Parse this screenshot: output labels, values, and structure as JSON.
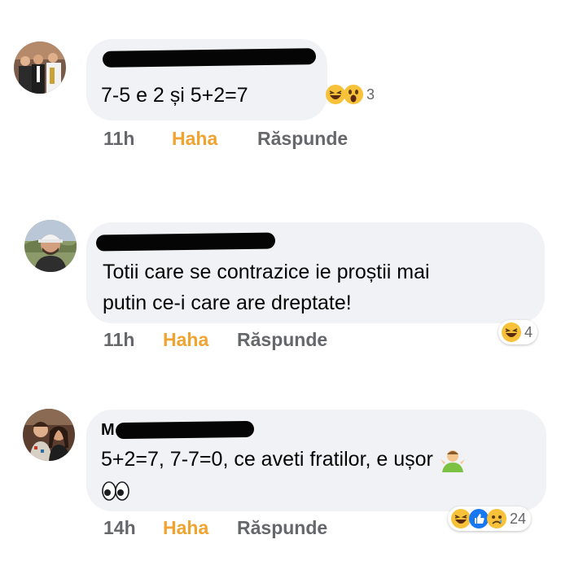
{
  "comments": [
    {
      "text_lines": [
        "7-5  e  2 și 5+2=7"
      ],
      "time": "11h",
      "haha_label": "Haha",
      "reply_label": "Răspunde",
      "reaction_count": "3",
      "reaction_icons": [
        "laughing-face-icon",
        "wow-face-icon"
      ]
    },
    {
      "text_lines": [
        "Totii care se contrazice ie proștii mai",
        "putin ce-i care are dreptate!"
      ],
      "time": "11h",
      "haha_label": "Haha",
      "reply_label": "Răspunde",
      "reaction_count": "4",
      "reaction_icons": [
        "laughing-face-icon"
      ]
    },
    {
      "name_initial": "M",
      "text_lines": [
        "5+2=7, 7-7=0, ce aveti fratilor, e ușor"
      ],
      "time": "14h",
      "haha_label": "Haha",
      "reply_label": "Răspunde",
      "reaction_count": "24",
      "reaction_icons": [
        "laughing-face-icon",
        "like-icon",
        "sad-face-icon"
      ]
    }
  ],
  "colors": {
    "bubble": "#f0f2f5",
    "meta_text": "#65676b",
    "haha_active": "#f0a32f",
    "like_blue": "#1877f2"
  }
}
